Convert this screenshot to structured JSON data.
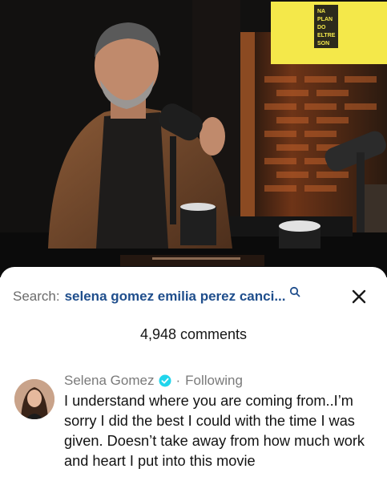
{
  "video": {
    "sign_text": [
      "NA",
      "PLAN",
      "DO",
      "ELTRE",
      "SON"
    ]
  },
  "search": {
    "label": "Search:",
    "query": "selena gomez emilia perez canci..."
  },
  "comments": {
    "count_text": "4,948 comments"
  },
  "comment": {
    "author": "Selena Gomez",
    "separator": "·",
    "follow_status": "Following",
    "text": "I understand where you are coming from..I’m sorry I did the best I could with the time I was given. Doesn’t take away from how much work and heart I put into this movie"
  },
  "colors": {
    "query": "#1f4e8c",
    "verified": "#20d5ec",
    "wall_orange": "#c0602a",
    "sign_yellow": "#f4e84a"
  },
  "icons": {
    "search": "search-icon",
    "close": "close-icon",
    "verified": "verified-badge-icon"
  }
}
